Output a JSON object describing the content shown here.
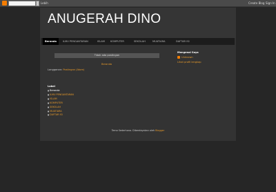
{
  "navbar": {
    "more_label": "Lebih",
    "create_blog": "Create Blog",
    "sign_in": "Sign In"
  },
  "blog": {
    "title": "ANUGERAH DINO"
  },
  "tabs": [
    {
      "label": "Beranda"
    },
    {
      "label": "ILMU PENGANTARAN"
    },
    {
      "label": "ISLAM"
    },
    {
      "label": "KOMPUTER"
    },
    {
      "label": "SEKOLAH"
    },
    {
      "label": "MUATIARA"
    },
    {
      "label": "DAFTAR ISI"
    }
  ],
  "main": {
    "notice": "Tidak ada postingan",
    "home_link": "Beranda",
    "category_prefix": "Langganan:",
    "category_link": "Postingan (Atom)"
  },
  "labels": {
    "heading": "Label",
    "items": [
      {
        "label": "Beranda"
      },
      {
        "label": "ILMU PENGANTARAN"
      },
      {
        "label": "ISLAM"
      },
      {
        "label": "KOMPUTER"
      },
      {
        "label": "SEKOLAH"
      },
      {
        "label": "MUATIARA"
      },
      {
        "label": "DAFTAR ISI"
      }
    ]
  },
  "sidebar": {
    "heading": "Mengenai Saya",
    "profile_name": "Unknown",
    "profile_link": "Lihat profil lengkap"
  },
  "footer": {
    "text": "Tema Sederhana. Diberdayakan oleh",
    "link": "Blogger"
  },
  "colors": {
    "accent": "#e89a2a",
    "background": "#262626",
    "content": "#333333"
  }
}
